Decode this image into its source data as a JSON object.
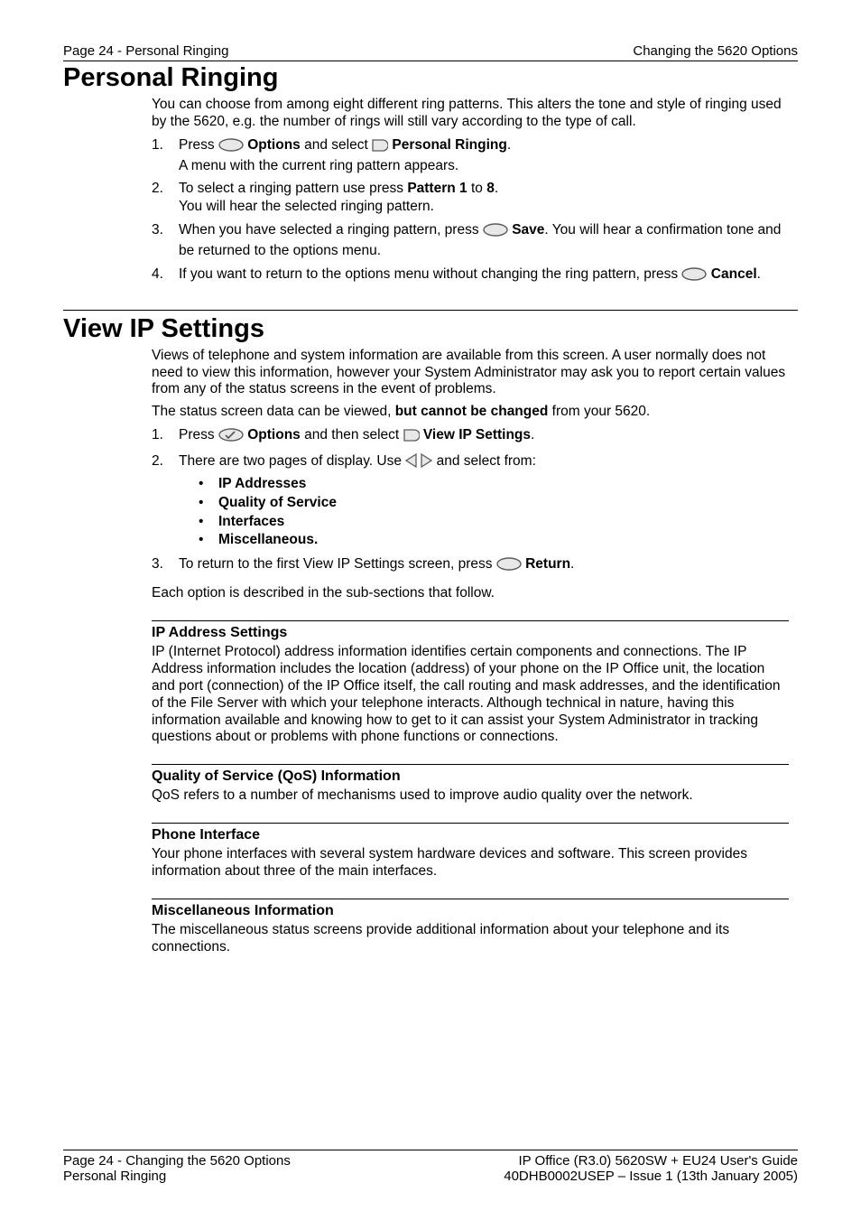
{
  "header": {
    "left": "Page 24 - Personal Ringing",
    "right": "Changing the 5620 Options"
  },
  "h1a": "Personal Ringing",
  "pr_intro": "You can choose from among eight different ring patterns. This alters the tone and style of ringing used by the 5620, e.g. the number of rings will still vary according to the type of call.",
  "pr": {
    "i1a": "Press ",
    "i1b": " Options",
    "i1c": " and select ",
    "i1d": " Personal Ringing",
    "i1e": ".",
    "i1f": "A menu with the current ring pattern appears.",
    "i2a": "To select a ringing pattern use press ",
    "i2b": "Pattern 1",
    "i2c": " to ",
    "i2d": "8",
    "i2e": ".",
    "i2f": "You will hear the selected ringing pattern.",
    "i3a": "When you have selected a ringing pattern, press ",
    "i3b": " Save",
    "i3c": ". You will hear a confirmation tone and be returned to the options menu.",
    "i4a": "If you want to return to the options menu without changing the ring pattern, press ",
    "i4b": " Cancel",
    "i4c": "."
  },
  "h1b": "View IP Settings",
  "vip_intro": "Views of telephone and system information are available from this screen. A user normally does not need to view this information, however your System Administrator may ask you to report certain values from any of the status screens in the event of problems.",
  "vip_status_a": "The status screen data can be viewed, ",
  "vip_status_b": "but cannot be changed",
  "vip_status_c": " from your 5620.",
  "vip": {
    "i1a": "Press ",
    "i1b": " Options",
    "i1c": " and then select ",
    "i1d": " View IP Settings",
    "i1e": ".",
    "i2a": "There are two pages of display. Use ",
    "i2b": " and select from:",
    "b1": "IP Addresses",
    "b2": "Quality of Service",
    "b3": "Interfaces",
    "b4": "Miscellaneous.",
    "i3a": "To return to the first View IP Settings screen, press ",
    "i3b": " Return",
    "i3c": "."
  },
  "vip_each": "Each option is described in the sub-sections that follow.",
  "s1h": "IP Address Settings",
  "s1p": "IP (Internet Protocol) address information identifies certain components and connections. The IP Address information includes the location (address) of your phone on the IP Office unit, the location and port (connection) of the IP Office itself, the call routing and mask addresses, and the identification of the File Server with which your telephone interacts. Although technical in nature, having this information available and knowing how to get to it can assist your System Administrator in tracking questions about or problems with phone functions or connections.",
  "s2h": "Quality of Service (QoS) Information",
  "s2p": "QoS refers to a number of mechanisms used to improve audio quality over the network.",
  "s3h": "Phone Interface",
  "s3p": "Your phone interfaces with several system hardware devices and software. This screen provides information about three of the main interfaces.",
  "s4h": "Miscellaneous Information",
  "s4p": "The miscellaneous status screens provide additional information about your telephone and its connections.",
  "footer": {
    "l1": "Page 24 - Changing the 5620 Options",
    "l2": "Personal Ringing",
    "r1": "IP Office (R3.0) 5620SW + EU24 User's Guide",
    "r2": "40DHB0002USEP – Issue 1 (13th January 2005)"
  }
}
